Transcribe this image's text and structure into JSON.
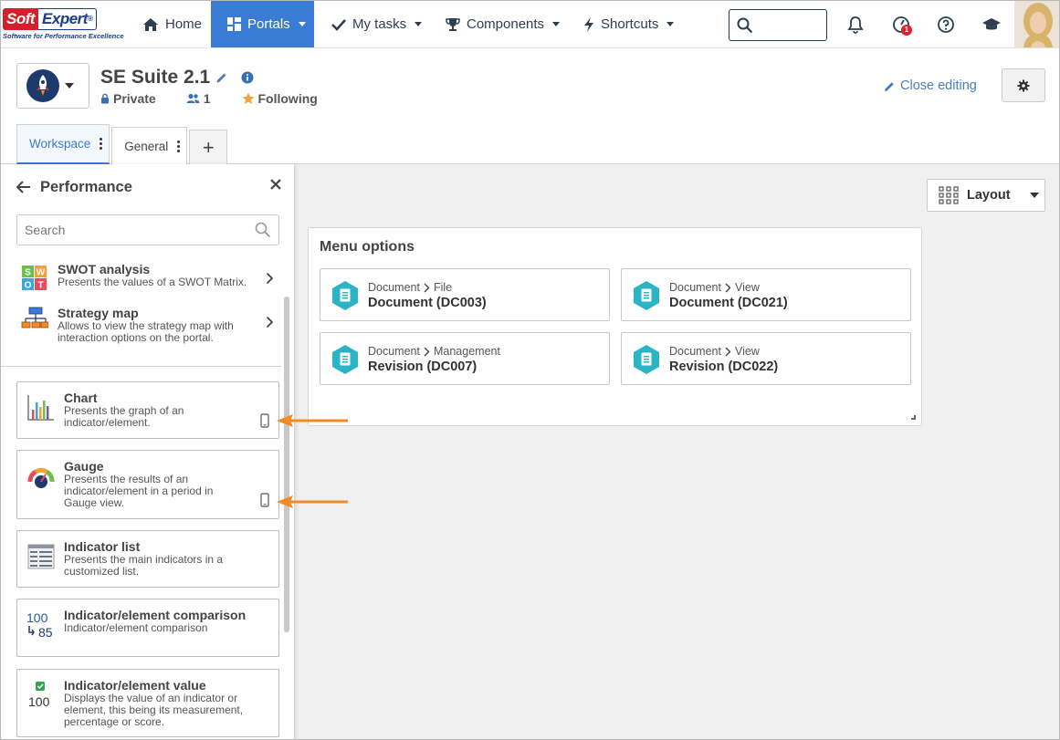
{
  "brand": {
    "logo_left": "Soft",
    "logo_right": "Expert",
    "logo_reg": "®",
    "tagline": "Software for Performance Excellence"
  },
  "nav": {
    "home": "Home",
    "portals": "Portals",
    "my_tasks": "My tasks",
    "components": "Components",
    "shortcuts": "Shortcuts",
    "notification_count": "1"
  },
  "portal": {
    "title": "SE Suite 2.1",
    "privacy": "Private",
    "members": "1",
    "following": "Following",
    "close_editing": "Close editing"
  },
  "tabs": [
    {
      "label": "Workspace"
    },
    {
      "label": "General"
    }
  ],
  "tab_add": "+",
  "panel": {
    "title": "Performance",
    "search_placeholder": "Search",
    "list": [
      {
        "title": "SWOT analysis",
        "desc": "Presents the values of a SWOT Matrix."
      },
      {
        "title": "Strategy map",
        "desc": "Allows to view the strategy map with interaction options on the portal."
      }
    ],
    "swot_letters": [
      "S",
      "W",
      "O",
      "T"
    ],
    "cards": [
      {
        "title": "Chart",
        "desc": "Presents the graph of an indicator/element."
      },
      {
        "title": "Gauge",
        "desc": "Presents the results of an indicator/element in a period in Gauge view."
      },
      {
        "title": "Indicator list",
        "desc": "Presents the main indicators in a customized list."
      },
      {
        "title": "Indicator/element comparison",
        "desc": "Indicator/element comparison"
      },
      {
        "title": "Indicator/element value",
        "desc": "Displays the value of an indicator or element, this being its measurement, percentage or score."
      }
    ],
    "icon_text": {
      "comparison_top": "100",
      "comparison_bottom": "85",
      "value": "100"
    }
  },
  "layout_button": "Layout",
  "widget": {
    "title": "Menu options",
    "items": [
      {
        "crumb_parent": "Document",
        "crumb_child": "File",
        "name": "Document (DC003)"
      },
      {
        "crumb_parent": "Document",
        "crumb_child": "View",
        "name": "Document (DC021)"
      },
      {
        "crumb_parent": "Document",
        "crumb_child": "Management",
        "name": "Revision (DC007)"
      },
      {
        "crumb_parent": "Document",
        "crumb_child": "View",
        "name": "Revision (DC022)"
      }
    ]
  },
  "colors": {
    "nav_active": "#3a7bd5",
    "menu_icon": "#2bb3c6",
    "annotation_arrow": "#f28a26",
    "badge": "#d9232d"
  }
}
